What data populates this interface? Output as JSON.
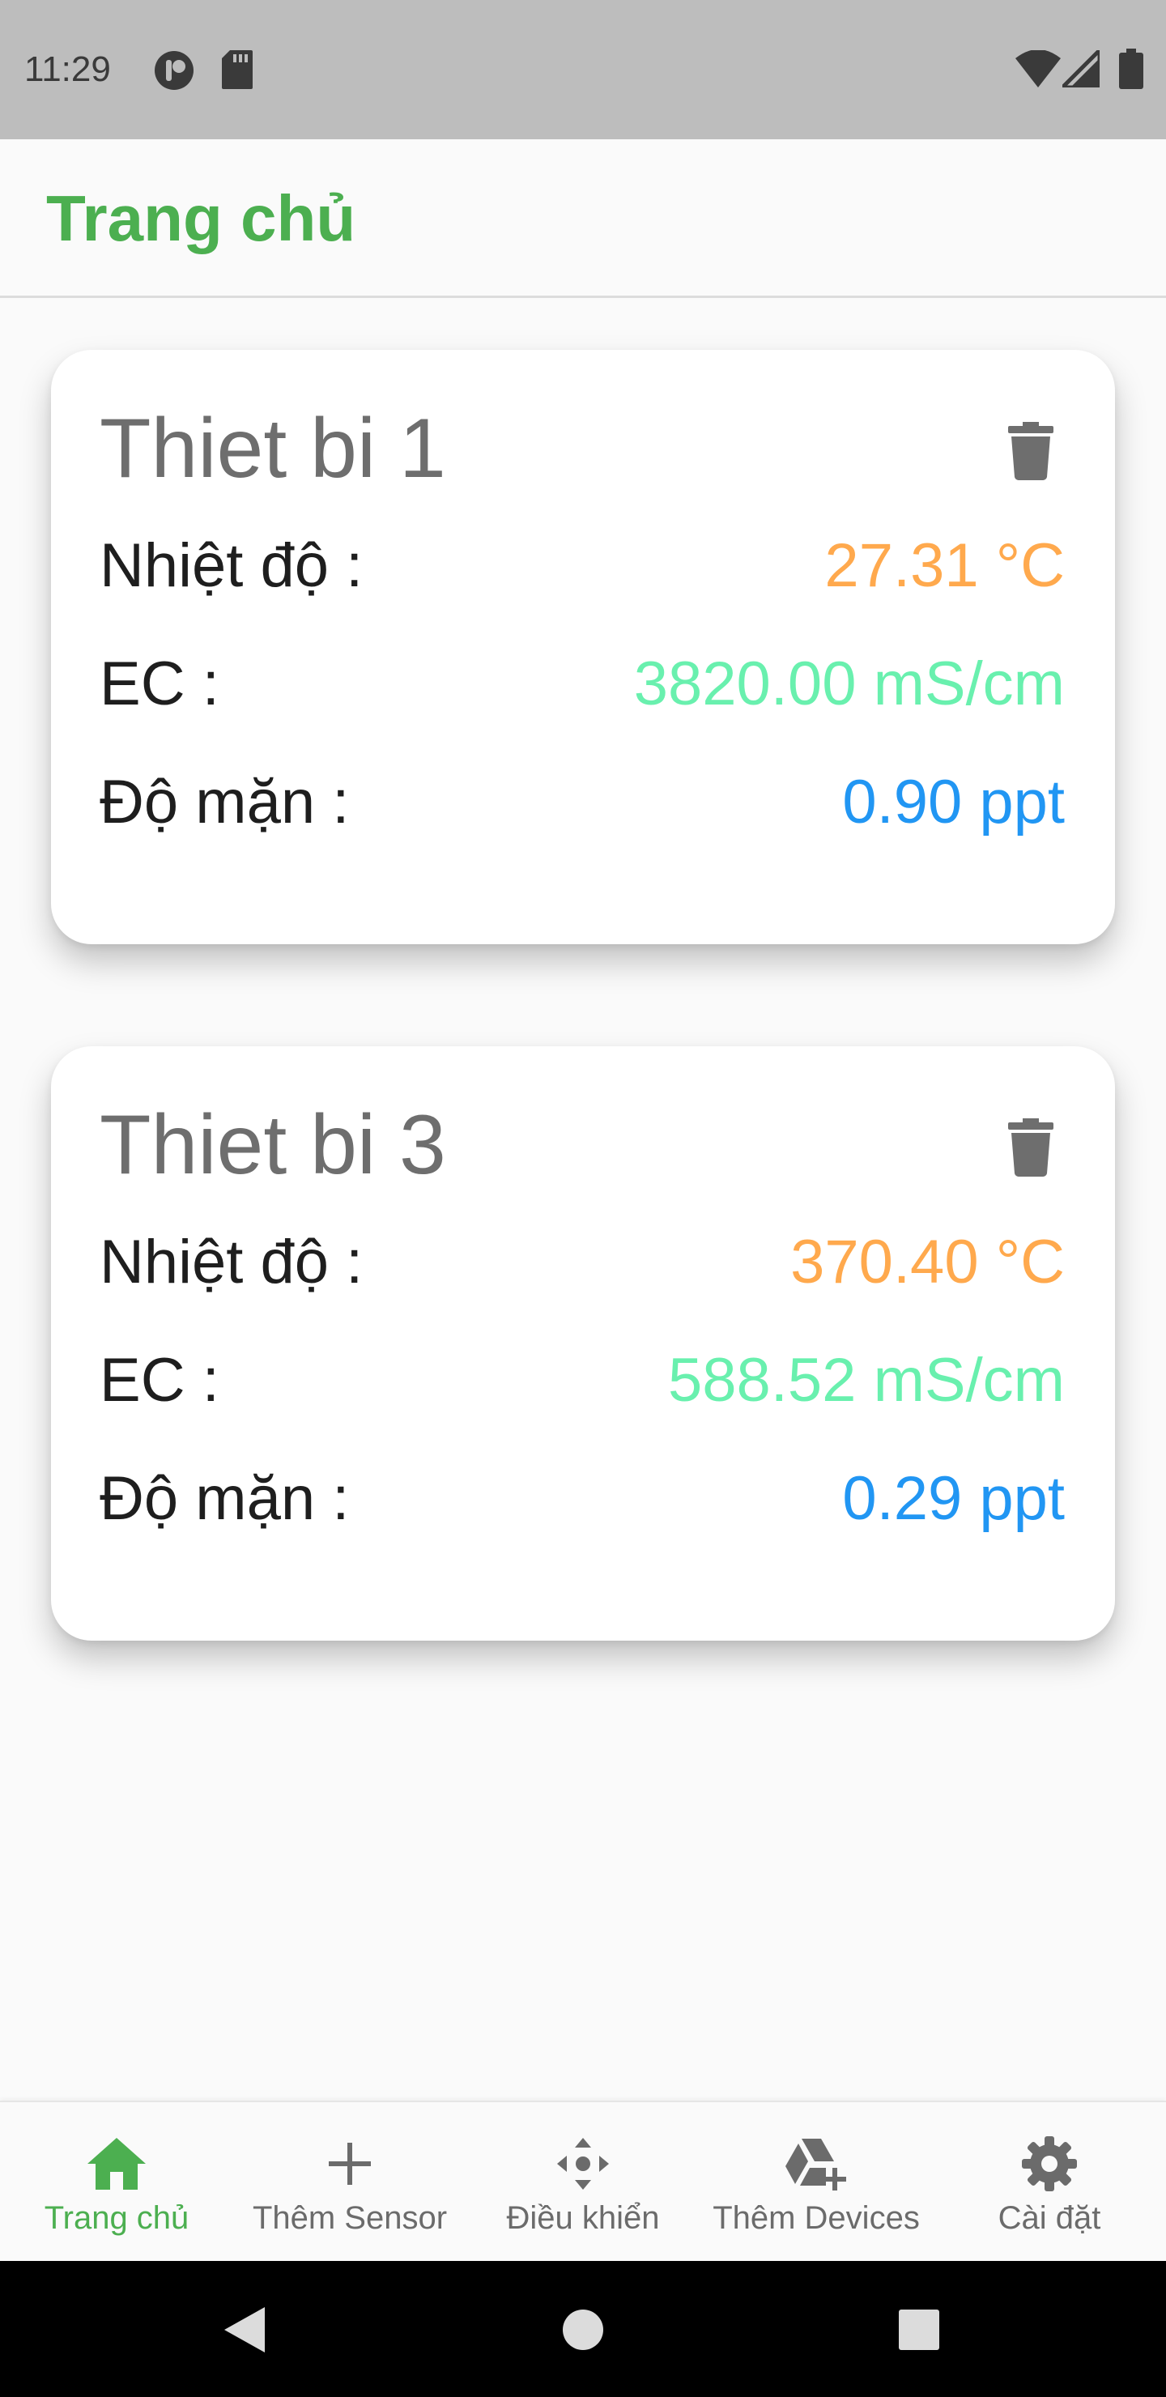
{
  "status_bar": {
    "time": "11:29",
    "left_icons": [
      "notification-app-icon",
      "sd-card-icon"
    ],
    "right_icons": [
      "wifi-icon",
      "cell-signal-icon",
      "battery-icon"
    ]
  },
  "app_bar": {
    "title": "Trang chủ"
  },
  "devices": [
    {
      "name": "Thiet bi 1",
      "delete_icon": "trash-icon",
      "metrics": [
        {
          "label": "Nhiệt độ :",
          "value": "27.31 °C"
        },
        {
          "label": "EC :",
          "value": "3820.00 mS/cm"
        },
        {
          "label": "Độ mặn :",
          "value": "0.90 ppt"
        }
      ]
    },
    {
      "name": "Thiet bi 3",
      "delete_icon": "trash-icon",
      "metrics": [
        {
          "label": "Nhiệt độ :",
          "value": "370.40 °C"
        },
        {
          "label": "EC :",
          "value": "588.52 mS/cm"
        },
        {
          "label": "Độ mặn :",
          "value": "0.29 ppt"
        }
      ]
    }
  ],
  "bottom_nav": {
    "items": [
      {
        "label": "Trang chủ",
        "icon": "home-icon",
        "active": true
      },
      {
        "label": "Thêm Sensor",
        "icon": "plus-icon",
        "active": false
      },
      {
        "label": "Điều khiển",
        "icon": "control-icon",
        "active": false
      },
      {
        "label": "Thêm Devices",
        "icon": "add-device-icon",
        "active": false
      },
      {
        "label": "Cài đặt",
        "icon": "gear-icon",
        "active": false
      }
    ]
  },
  "system_nav": {
    "buttons": [
      "back-icon",
      "home-circle-icon",
      "recents-icon"
    ]
  },
  "colors": {
    "accent": "#4caf50",
    "temperature": "#ffa94d",
    "ec": "#69f0ae",
    "salinity": "#2196f3",
    "inactive": "#6b6b6b"
  }
}
